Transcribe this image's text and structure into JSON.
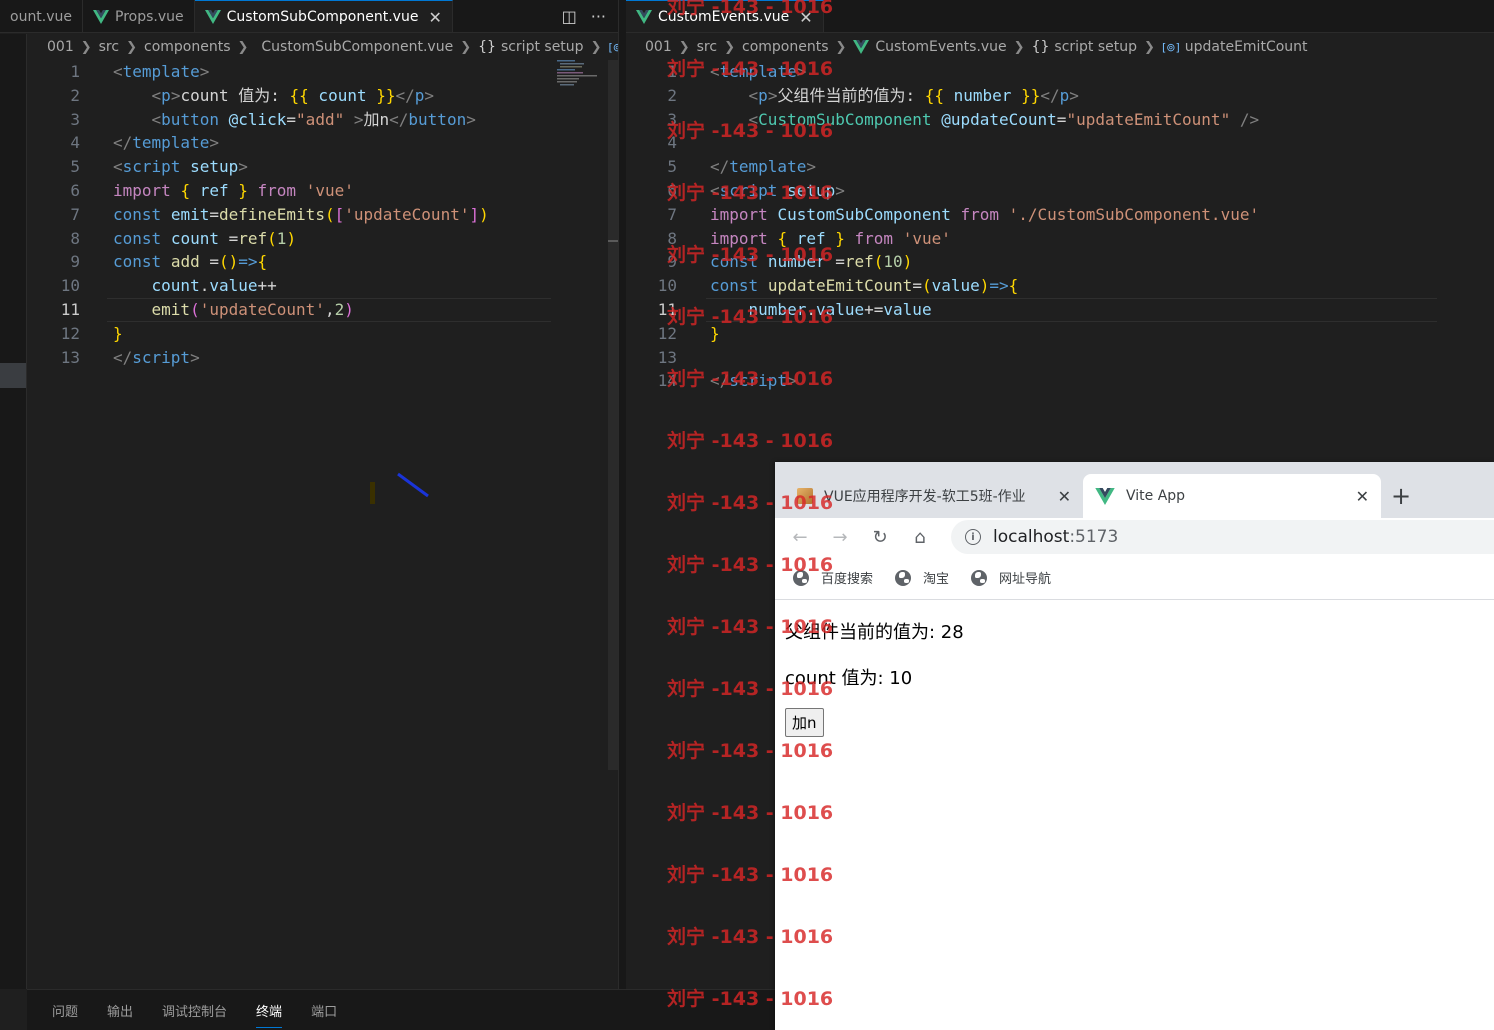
{
  "left_tabs": [
    {
      "label": "ount.vue",
      "vue": false,
      "active": false
    },
    {
      "label": "Props.vue",
      "vue": true,
      "active": false
    },
    {
      "label": "CustomSubComponent.vue",
      "vue": true,
      "active": true,
      "close": "✕"
    }
  ],
  "left_tab_actions": {
    "split": "◫",
    "more": "···"
  },
  "right_tabs": [
    {
      "label": "CustomEvents.vue",
      "vue": true,
      "active": true,
      "close": "✕"
    }
  ],
  "left_breadcrumb": {
    "folder1": "001",
    "folder2": "src",
    "folder3": "components",
    "file": "CustomSubComponent.vue",
    "scope_icon": "{}",
    "scope": "script setup",
    "tail_icon": "[⊚]"
  },
  "right_breadcrumb": {
    "folder1": "001",
    "folder2": "src",
    "folder3": "components",
    "file": "CustomEvents.vue",
    "scope_icon": "{}",
    "scope": "script setup",
    "symbol_icon": "[⊚]",
    "symbol": "updateEmitCount"
  },
  "left_code": [
    {
      "n": "1",
      "cur": false,
      "tokens": [
        [
          "t-brk",
          "<"
        ],
        [
          "t-tag",
          "template"
        ],
        [
          "t-brk",
          ">"
        ]
      ]
    },
    {
      "n": "2",
      "cur": false,
      "tokens": [
        [
          "t-plain",
          "    "
        ],
        [
          "t-brk",
          "<"
        ],
        [
          "t-tag",
          "p"
        ],
        [
          "t-brk",
          ">"
        ],
        [
          "t-plain",
          "count 值为: "
        ],
        [
          "t-b1",
          "{{"
        ],
        [
          "t-var",
          " count "
        ],
        [
          "t-b1",
          "}}"
        ],
        [
          "t-brk",
          "</"
        ],
        [
          "t-tag",
          "p"
        ],
        [
          "t-brk",
          ">"
        ]
      ]
    },
    {
      "n": "3",
      "cur": false,
      "tokens": [
        [
          "t-plain",
          "    "
        ],
        [
          "t-brk",
          "<"
        ],
        [
          "t-tag",
          "button"
        ],
        [
          "t-plain",
          " "
        ],
        [
          "t-attr",
          "@click"
        ],
        [
          "t-plain",
          "="
        ],
        [
          "t-str",
          "\"add\""
        ],
        [
          "t-plain",
          " "
        ],
        [
          "t-brk",
          ">"
        ],
        [
          "t-plain",
          "加n"
        ],
        [
          "t-brk",
          "</"
        ],
        [
          "t-tag",
          "button"
        ],
        [
          "t-brk",
          ">"
        ]
      ]
    },
    {
      "n": "4",
      "cur": false,
      "tokens": [
        [
          "t-brk",
          "</"
        ],
        [
          "t-tag",
          "template"
        ],
        [
          "t-brk",
          ">"
        ]
      ]
    },
    {
      "n": "5",
      "cur": false,
      "tokens": [
        [
          "t-brk",
          "<"
        ],
        [
          "t-tag",
          "script"
        ],
        [
          "t-plain",
          " "
        ],
        [
          "t-attr",
          "setup"
        ],
        [
          "t-brk",
          ">"
        ]
      ]
    },
    {
      "n": "6",
      "cur": false,
      "tokens": [
        [
          "t-ctl",
          "import"
        ],
        [
          "t-plain",
          " "
        ],
        [
          "t-b1",
          "{"
        ],
        [
          "t-var",
          " ref "
        ],
        [
          "t-b1",
          "}"
        ],
        [
          "t-plain",
          " "
        ],
        [
          "t-ctl",
          "from"
        ],
        [
          "t-plain",
          " "
        ],
        [
          "t-str",
          "'vue'"
        ]
      ]
    },
    {
      "n": "7",
      "cur": false,
      "tokens": [
        [
          "t-kw",
          "const"
        ],
        [
          "t-plain",
          " "
        ],
        [
          "t-var",
          "emit"
        ],
        [
          "t-plain",
          "="
        ],
        [
          "t-fn",
          "defineEmits"
        ],
        [
          "t-b1",
          "("
        ],
        [
          "t-b2",
          "["
        ],
        [
          "t-str",
          "'updateCount'"
        ],
        [
          "t-b2",
          "]"
        ],
        [
          "t-b1",
          ")"
        ]
      ]
    },
    {
      "n": "8",
      "cur": false,
      "tokens": [
        [
          "t-kw",
          "const"
        ],
        [
          "t-plain",
          " "
        ],
        [
          "t-var",
          "count"
        ],
        [
          "t-plain",
          " ="
        ],
        [
          "t-fn",
          "ref"
        ],
        [
          "t-b1",
          "("
        ],
        [
          "t-num",
          "1"
        ],
        [
          "t-b1",
          ")"
        ]
      ]
    },
    {
      "n": "9",
      "cur": false,
      "tokens": [
        [
          "t-kw",
          "const"
        ],
        [
          "t-plain",
          " "
        ],
        [
          "t-fn",
          "add"
        ],
        [
          "t-plain",
          " ="
        ],
        [
          "t-b1",
          "("
        ],
        [
          "t-b1",
          ")"
        ],
        [
          "t-kw",
          "=>"
        ],
        [
          "t-b1",
          "{"
        ]
      ]
    },
    {
      "n": "10",
      "cur": false,
      "tokens": [
        [
          "t-plain",
          "    "
        ],
        [
          "t-var",
          "count"
        ],
        [
          "t-plain",
          "."
        ],
        [
          "t-var",
          "value"
        ],
        [
          "t-plain",
          "++"
        ]
      ]
    },
    {
      "n": "11",
      "cur": true,
      "tokens": [
        [
          "t-plain",
          "    "
        ],
        [
          "t-fn",
          "emit"
        ],
        [
          "t-b2",
          "("
        ],
        [
          "t-str",
          "'updateCount'"
        ],
        [
          "t-plain",
          ","
        ],
        [
          "t-num",
          "2"
        ],
        [
          "t-b2",
          ")"
        ]
      ]
    },
    {
      "n": "12",
      "cur": false,
      "tokens": [
        [
          "t-b1",
          "}"
        ]
      ]
    },
    {
      "n": "13",
      "cur": false,
      "tokens": [
        [
          "t-brk",
          "</"
        ],
        [
          "t-tag",
          "script"
        ],
        [
          "t-brk",
          ">"
        ]
      ]
    }
  ],
  "right_code": [
    {
      "n": "1",
      "cur": false,
      "tokens": [
        [
          "t-brk",
          "<"
        ],
        [
          "t-tag",
          "template"
        ],
        [
          "t-brk",
          ">"
        ]
      ]
    },
    {
      "n": "2",
      "cur": false,
      "tokens": [
        [
          "t-plain",
          "    "
        ],
        [
          "t-brk",
          "<"
        ],
        [
          "t-tag",
          "p"
        ],
        [
          "t-brk",
          ">"
        ],
        [
          "t-plain",
          "父组件当前的值为: "
        ],
        [
          "t-b1",
          "{{"
        ],
        [
          "t-var",
          " number "
        ],
        [
          "t-b1",
          "}}"
        ],
        [
          "t-brk",
          "</"
        ],
        [
          "t-tag",
          "p"
        ],
        [
          "t-brk",
          ">"
        ]
      ]
    },
    {
      "n": "3",
      "cur": false,
      "tokens": [
        [
          "t-plain",
          "    "
        ],
        [
          "t-brk",
          "<"
        ],
        [
          "t-comp",
          "CustomSubComponent"
        ],
        [
          "t-plain",
          " "
        ],
        [
          "t-attr",
          "@updateCount"
        ],
        [
          "t-plain",
          "="
        ],
        [
          "t-str",
          "\"updateEmitCount\""
        ],
        [
          "t-plain",
          " "
        ],
        [
          "t-brk",
          "/>"
        ]
      ]
    },
    {
      "n": "4",
      "cur": false,
      "tokens": []
    },
    {
      "n": "5",
      "cur": false,
      "tokens": [
        [
          "t-brk",
          "</"
        ],
        [
          "t-tag",
          "template"
        ],
        [
          "t-brk",
          ">"
        ]
      ]
    },
    {
      "n": "6",
      "cur": false,
      "tokens": [
        [
          "t-brk",
          "<"
        ],
        [
          "t-tag",
          "script"
        ],
        [
          "t-plain",
          " "
        ],
        [
          "t-attr",
          "setup"
        ],
        [
          "t-brk",
          ">"
        ]
      ]
    },
    {
      "n": "7",
      "cur": false,
      "tokens": [
        [
          "t-ctl",
          "import"
        ],
        [
          "t-plain",
          " "
        ],
        [
          "t-var",
          "CustomSubComponent"
        ],
        [
          "t-plain",
          " "
        ],
        [
          "t-ctl",
          "from"
        ],
        [
          "t-plain",
          " "
        ],
        [
          "t-str",
          "'./CustomSubComponent.vue'"
        ]
      ]
    },
    {
      "n": "8",
      "cur": false,
      "tokens": [
        [
          "t-ctl",
          "import"
        ],
        [
          "t-plain",
          " "
        ],
        [
          "t-b1",
          "{"
        ],
        [
          "t-var",
          " ref "
        ],
        [
          "t-b1",
          "}"
        ],
        [
          "t-plain",
          " "
        ],
        [
          "t-ctl",
          "from"
        ],
        [
          "t-plain",
          " "
        ],
        [
          "t-str",
          "'vue'"
        ]
      ]
    },
    {
      "n": "9",
      "cur": false,
      "tokens": [
        [
          "t-kw",
          "const"
        ],
        [
          "t-plain",
          " "
        ],
        [
          "t-var",
          "number"
        ],
        [
          "t-plain",
          " ="
        ],
        [
          "t-fn",
          "ref"
        ],
        [
          "t-b1",
          "("
        ],
        [
          "t-num",
          "10"
        ],
        [
          "t-b1",
          ")"
        ]
      ]
    },
    {
      "n": "10",
      "cur": false,
      "tokens": [
        [
          "t-kw",
          "const"
        ],
        [
          "t-plain",
          " "
        ],
        [
          "t-fn",
          "updateEmitCount"
        ],
        [
          "t-plain",
          "="
        ],
        [
          "t-b1",
          "("
        ],
        [
          "t-var",
          "value"
        ],
        [
          "t-b1",
          ")"
        ],
        [
          "t-kw",
          "=>"
        ],
        [
          "t-b1",
          "{"
        ]
      ]
    },
    {
      "n": "11",
      "cur": true,
      "tokens": [
        [
          "t-plain",
          "    "
        ],
        [
          "t-var",
          "number"
        ],
        [
          "t-plain",
          "."
        ],
        [
          "t-var",
          "value"
        ],
        [
          "t-plain",
          "+="
        ],
        [
          "t-var",
          "value"
        ]
      ]
    },
    {
      "n": "12",
      "cur": false,
      "tokens": [
        [
          "t-b1",
          "}"
        ]
      ]
    },
    {
      "n": "13",
      "cur": false,
      "tokens": []
    },
    {
      "n": "14",
      "cur": false,
      "tokens": [
        [
          "t-brk",
          "</"
        ],
        [
          "t-tag",
          "script"
        ],
        [
          "t-brk",
          ">"
        ]
      ]
    }
  ],
  "panel_tabs": [
    {
      "label": "问题",
      "active": false
    },
    {
      "label": "输出",
      "active": false
    },
    {
      "label": "调试控制台",
      "active": false
    },
    {
      "label": "终端",
      "active": true
    },
    {
      "label": "端口",
      "active": false
    }
  ],
  "browser": {
    "tabs": [
      {
        "label": "VUE应用程序开发-软工5班-作业",
        "close": "✕",
        "active": false,
        "icon": "book-icon"
      },
      {
        "label": "Vite App",
        "close": "✕",
        "active": true,
        "icon": "vue-logo-icon"
      }
    ],
    "new_tab": "+",
    "back": "←",
    "forward": "→",
    "reload": "↻",
    "home": "⌂",
    "url_host": "localhost",
    "url_port": ":5173",
    "bookmarks": [
      "百度搜索",
      "淘宝",
      "网址导航"
    ],
    "content": {
      "parent_text": "父组件当前的值为: 28",
      "child_text": "count 值为: 10",
      "button_label": "加n"
    }
  },
  "watermark": "刘宁 -143 - 1016",
  "colors": {
    "vue_green": "#41b883",
    "vue_dark": "#34495e",
    "accent_blue": "#0078d4",
    "watermark_red": "#d72626"
  }
}
